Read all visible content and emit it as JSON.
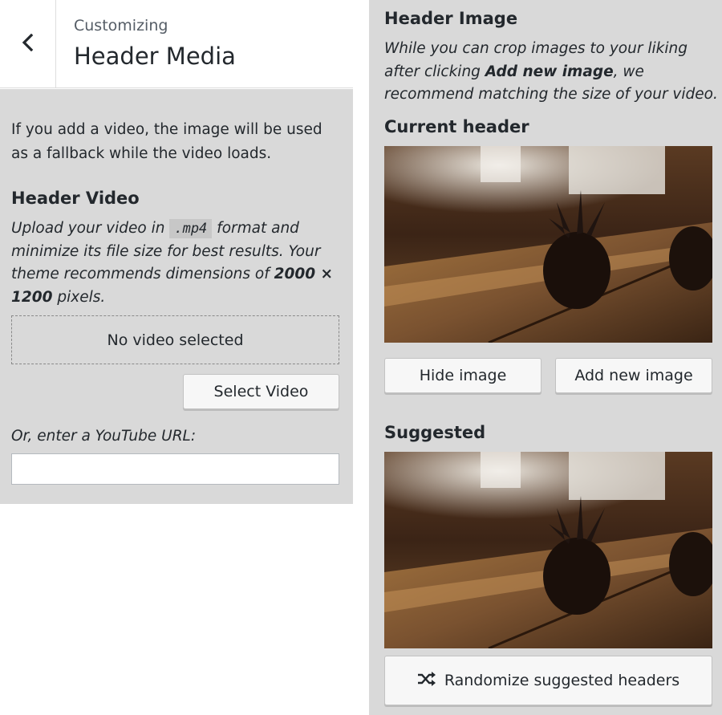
{
  "header": {
    "breadcrumb": "Customizing",
    "title": "Header Media",
    "back_icon": "chevron-left-icon"
  },
  "left": {
    "intro": "If you add a video, the image will be used as a fallback while the video loads.",
    "video_section_title": "Header Video",
    "video_desc_before": "Upload your video in ",
    "video_format": ".mp4",
    "video_desc_middle": " format and minimize its file size for best results. Your theme recommends dimensions of ",
    "video_dimensions": "2000 × 1200",
    "video_desc_after": " pixels.",
    "dropzone_text": "No video selected",
    "select_video_label": "Select Video",
    "youtube_label": "Or, enter a YouTube URL:",
    "youtube_value": ""
  },
  "right": {
    "image_section_title": "Header Image",
    "image_desc_before": "While you can crop images to your liking after clicking ",
    "image_desc_bold": "Add new image",
    "image_desc_after": ", we recommend matching the size of your video.",
    "current_title": "Current header",
    "hide_label": "Hide image",
    "add_label": "Add new image",
    "suggested_title": "Suggested",
    "randomize_label": "Randomize suggested headers",
    "randomize_icon": "shuffle-icon"
  }
}
